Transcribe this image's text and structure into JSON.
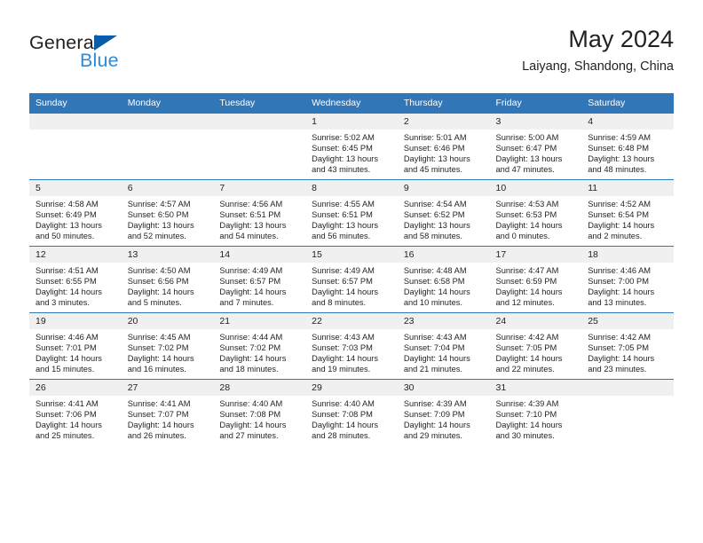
{
  "brand": {
    "name_part1": "General",
    "name_part2": "Blue",
    "triangle_icon": "blue-triangle-logo-mark",
    "color_dark": "#231f20",
    "color_blue": "#2e8bd8",
    "color_triangle": "#0a5ca8"
  },
  "header": {
    "title": "May 2024",
    "subtitle": "Laiyang, Shandong, China"
  },
  "theme": {
    "header_bg": "#3177b8",
    "daynum_bg": "#f0f0f0",
    "row_divider": "#3177b8",
    "text": "#231f20"
  },
  "weekdays": [
    "Sunday",
    "Monday",
    "Tuesday",
    "Wednesday",
    "Thursday",
    "Friday",
    "Saturday"
  ],
  "weeks": [
    [
      {
        "day": "",
        "empty": true,
        "sunrise": "",
        "sunset": "",
        "daylight1": "",
        "daylight2": ""
      },
      {
        "day": "",
        "empty": true,
        "sunrise": "",
        "sunset": "",
        "daylight1": "",
        "daylight2": ""
      },
      {
        "day": "",
        "empty": true,
        "sunrise": "",
        "sunset": "",
        "daylight1": "",
        "daylight2": ""
      },
      {
        "day": "1",
        "empty": false,
        "sunrise": "Sunrise: 5:02 AM",
        "sunset": "Sunset: 6:45 PM",
        "daylight1": "Daylight: 13 hours",
        "daylight2": "and 43 minutes."
      },
      {
        "day": "2",
        "empty": false,
        "sunrise": "Sunrise: 5:01 AM",
        "sunset": "Sunset: 6:46 PM",
        "daylight1": "Daylight: 13 hours",
        "daylight2": "and 45 minutes."
      },
      {
        "day": "3",
        "empty": false,
        "sunrise": "Sunrise: 5:00 AM",
        "sunset": "Sunset: 6:47 PM",
        "daylight1": "Daylight: 13 hours",
        "daylight2": "and 47 minutes."
      },
      {
        "day": "4",
        "empty": false,
        "sunrise": "Sunrise: 4:59 AM",
        "sunset": "Sunset: 6:48 PM",
        "daylight1": "Daylight: 13 hours",
        "daylight2": "and 48 minutes."
      }
    ],
    [
      {
        "day": "5",
        "empty": false,
        "sunrise": "Sunrise: 4:58 AM",
        "sunset": "Sunset: 6:49 PM",
        "daylight1": "Daylight: 13 hours",
        "daylight2": "and 50 minutes."
      },
      {
        "day": "6",
        "empty": false,
        "sunrise": "Sunrise: 4:57 AM",
        "sunset": "Sunset: 6:50 PM",
        "daylight1": "Daylight: 13 hours",
        "daylight2": "and 52 minutes."
      },
      {
        "day": "7",
        "empty": false,
        "sunrise": "Sunrise: 4:56 AM",
        "sunset": "Sunset: 6:51 PM",
        "daylight1": "Daylight: 13 hours",
        "daylight2": "and 54 minutes."
      },
      {
        "day": "8",
        "empty": false,
        "sunrise": "Sunrise: 4:55 AM",
        "sunset": "Sunset: 6:51 PM",
        "daylight1": "Daylight: 13 hours",
        "daylight2": "and 56 minutes."
      },
      {
        "day": "9",
        "empty": false,
        "sunrise": "Sunrise: 4:54 AM",
        "sunset": "Sunset: 6:52 PM",
        "daylight1": "Daylight: 13 hours",
        "daylight2": "and 58 minutes."
      },
      {
        "day": "10",
        "empty": false,
        "sunrise": "Sunrise: 4:53 AM",
        "sunset": "Sunset: 6:53 PM",
        "daylight1": "Daylight: 14 hours",
        "daylight2": "and 0 minutes."
      },
      {
        "day": "11",
        "empty": false,
        "sunrise": "Sunrise: 4:52 AM",
        "sunset": "Sunset: 6:54 PM",
        "daylight1": "Daylight: 14 hours",
        "daylight2": "and 2 minutes."
      }
    ],
    [
      {
        "day": "12",
        "empty": false,
        "sunrise": "Sunrise: 4:51 AM",
        "sunset": "Sunset: 6:55 PM",
        "daylight1": "Daylight: 14 hours",
        "daylight2": "and 3 minutes."
      },
      {
        "day": "13",
        "empty": false,
        "sunrise": "Sunrise: 4:50 AM",
        "sunset": "Sunset: 6:56 PM",
        "daylight1": "Daylight: 14 hours",
        "daylight2": "and 5 minutes."
      },
      {
        "day": "14",
        "empty": false,
        "sunrise": "Sunrise: 4:49 AM",
        "sunset": "Sunset: 6:57 PM",
        "daylight1": "Daylight: 14 hours",
        "daylight2": "and 7 minutes."
      },
      {
        "day": "15",
        "empty": false,
        "sunrise": "Sunrise: 4:49 AM",
        "sunset": "Sunset: 6:57 PM",
        "daylight1": "Daylight: 14 hours",
        "daylight2": "and 8 minutes."
      },
      {
        "day": "16",
        "empty": false,
        "sunrise": "Sunrise: 4:48 AM",
        "sunset": "Sunset: 6:58 PM",
        "daylight1": "Daylight: 14 hours",
        "daylight2": "and 10 minutes."
      },
      {
        "day": "17",
        "empty": false,
        "sunrise": "Sunrise: 4:47 AM",
        "sunset": "Sunset: 6:59 PM",
        "daylight1": "Daylight: 14 hours",
        "daylight2": "and 12 minutes."
      },
      {
        "day": "18",
        "empty": false,
        "sunrise": "Sunrise: 4:46 AM",
        "sunset": "Sunset: 7:00 PM",
        "daylight1": "Daylight: 14 hours",
        "daylight2": "and 13 minutes."
      }
    ],
    [
      {
        "day": "19",
        "empty": false,
        "sunrise": "Sunrise: 4:46 AM",
        "sunset": "Sunset: 7:01 PM",
        "daylight1": "Daylight: 14 hours",
        "daylight2": "and 15 minutes."
      },
      {
        "day": "20",
        "empty": false,
        "sunrise": "Sunrise: 4:45 AM",
        "sunset": "Sunset: 7:02 PM",
        "daylight1": "Daylight: 14 hours",
        "daylight2": "and 16 minutes."
      },
      {
        "day": "21",
        "empty": false,
        "sunrise": "Sunrise: 4:44 AM",
        "sunset": "Sunset: 7:02 PM",
        "daylight1": "Daylight: 14 hours",
        "daylight2": "and 18 minutes."
      },
      {
        "day": "22",
        "empty": false,
        "sunrise": "Sunrise: 4:43 AM",
        "sunset": "Sunset: 7:03 PM",
        "daylight1": "Daylight: 14 hours",
        "daylight2": "and 19 minutes."
      },
      {
        "day": "23",
        "empty": false,
        "sunrise": "Sunrise: 4:43 AM",
        "sunset": "Sunset: 7:04 PM",
        "daylight1": "Daylight: 14 hours",
        "daylight2": "and 21 minutes."
      },
      {
        "day": "24",
        "empty": false,
        "sunrise": "Sunrise: 4:42 AM",
        "sunset": "Sunset: 7:05 PM",
        "daylight1": "Daylight: 14 hours",
        "daylight2": "and 22 minutes."
      },
      {
        "day": "25",
        "empty": false,
        "sunrise": "Sunrise: 4:42 AM",
        "sunset": "Sunset: 7:05 PM",
        "daylight1": "Daylight: 14 hours",
        "daylight2": "and 23 minutes."
      }
    ],
    [
      {
        "day": "26",
        "empty": false,
        "sunrise": "Sunrise: 4:41 AM",
        "sunset": "Sunset: 7:06 PM",
        "daylight1": "Daylight: 14 hours",
        "daylight2": "and 25 minutes."
      },
      {
        "day": "27",
        "empty": false,
        "sunrise": "Sunrise: 4:41 AM",
        "sunset": "Sunset: 7:07 PM",
        "daylight1": "Daylight: 14 hours",
        "daylight2": "and 26 minutes."
      },
      {
        "day": "28",
        "empty": false,
        "sunrise": "Sunrise: 4:40 AM",
        "sunset": "Sunset: 7:08 PM",
        "daylight1": "Daylight: 14 hours",
        "daylight2": "and 27 minutes."
      },
      {
        "day": "29",
        "empty": false,
        "sunrise": "Sunrise: 4:40 AM",
        "sunset": "Sunset: 7:08 PM",
        "daylight1": "Daylight: 14 hours",
        "daylight2": "and 28 minutes."
      },
      {
        "day": "30",
        "empty": false,
        "sunrise": "Sunrise: 4:39 AM",
        "sunset": "Sunset: 7:09 PM",
        "daylight1": "Daylight: 14 hours",
        "daylight2": "and 29 minutes."
      },
      {
        "day": "31",
        "empty": false,
        "sunrise": "Sunrise: 4:39 AM",
        "sunset": "Sunset: 7:10 PM",
        "daylight1": "Daylight: 14 hours",
        "daylight2": "and 30 minutes."
      },
      {
        "day": "",
        "empty": true,
        "sunrise": "",
        "sunset": "",
        "daylight1": "",
        "daylight2": ""
      }
    ]
  ]
}
